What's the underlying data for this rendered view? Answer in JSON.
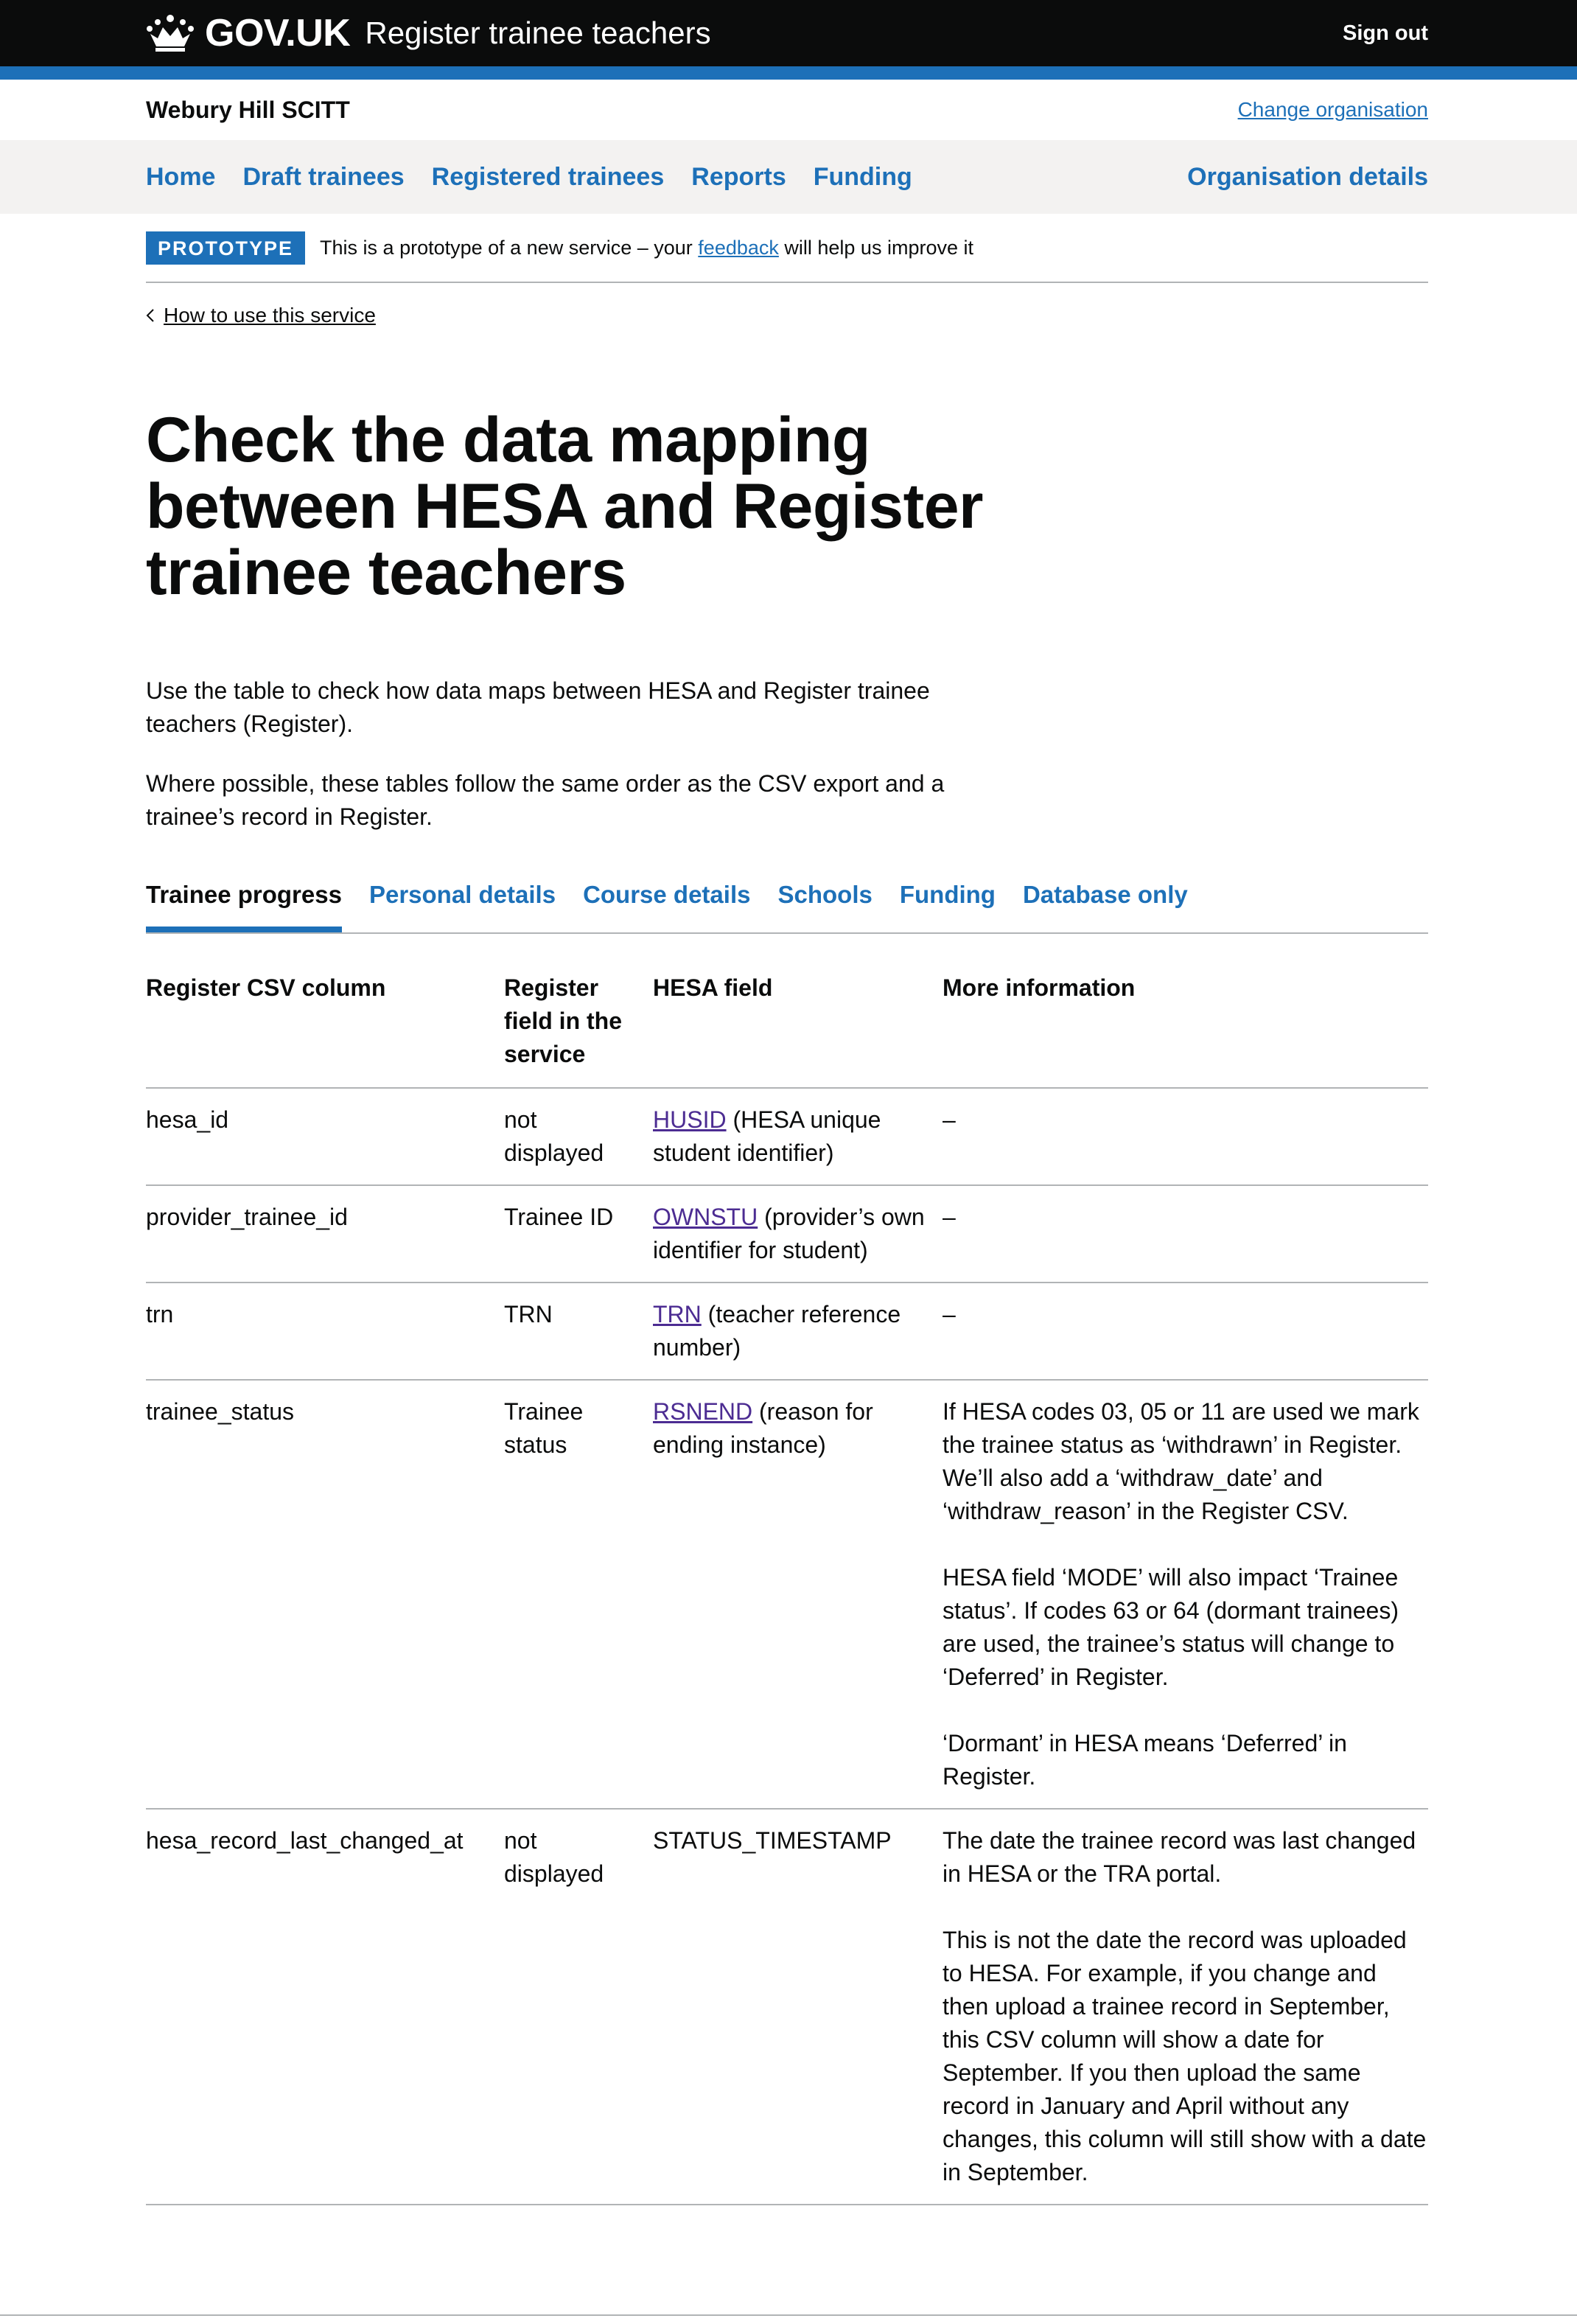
{
  "header": {
    "logo_text": "GOV.UK",
    "service_name": "Register trainee teachers",
    "sign_out": "Sign out"
  },
  "org": {
    "name": "Webury Hill SCITT",
    "change_link": "Change organisation"
  },
  "nav": {
    "items": [
      "Home",
      "Draft trainees",
      "Registered trainees",
      "Reports",
      "Funding"
    ],
    "right": "Organisation details"
  },
  "phase": {
    "tag": "PROTOTYPE",
    "before": "This is a prototype of a new service – your ",
    "link": "feedback",
    "after": " will help us improve it"
  },
  "back_link": "How to use this service",
  "page": {
    "title": "Check the data mapping between HESA and Register trainee teachers",
    "intro_1": "Use the table to check how data maps between HESA and Register trainee teachers (Register).",
    "intro_2": "Where possible, these tables follow the same order as the CSV export and a trainee’s record in Register."
  },
  "tabs": [
    "Trainee progress",
    "Personal details",
    "Course details",
    "Schools",
    "Funding",
    "Database only"
  ],
  "table": {
    "headers": [
      "Register CSV column",
      "Register field in the service",
      "HESA field",
      "More information"
    ],
    "rows": [
      {
        "csv": "hesa_id",
        "register": "not displayed",
        "hesa_link": "HUSID",
        "hesa_text": " (HESA unique student identifier)",
        "info": [
          "–"
        ]
      },
      {
        "csv": "provider_trainee_id",
        "register": "Trainee ID",
        "hesa_link": "OWNSTU",
        "hesa_text": " (provider’s own identifier for student)",
        "info": [
          "–"
        ]
      },
      {
        "csv": "trn",
        "register": "TRN",
        "hesa_link": "TRN",
        "hesa_text": " (teacher reference number)",
        "info": [
          "–"
        ]
      },
      {
        "csv": "trainee_status",
        "register": "Trainee status",
        "hesa_link": "RSNEND",
        "hesa_text": " (reason for ending instance)",
        "info": [
          "If HESA codes 03, 05 or 11 are used we mark the trainee status as ‘withdrawn’ in Register. We’ll also add a ‘withdraw_date’ and ‘withdraw_reason’ in the Register CSV.",
          "HESA field ‘MODE’ will also impact ‘Trainee status’. If codes 63 or 64 (dormant trainees) are used, the trainee’s status will change to ‘Deferred’ in Register.",
          "‘Dormant’ in HESA means ‘Deferred’ in Register."
        ]
      },
      {
        "csv": "hesa_record_last_changed_at",
        "register": "not displayed",
        "hesa_link": "",
        "hesa_text": "STATUS_TIMESTAMP",
        "info": [
          "The date the trainee record was last changed in HESA or the TRA portal.",
          "This is not the date the record was uploaded to HESA. For example, if you change and then upload a trainee record in September, this CSV column will show a date for September. If you then upload the same record in January and April without any changes, this column will still show with a date in September."
        ]
      }
    ]
  },
  "colors": {
    "header_bg": "#0b0c0c",
    "brand_blue": "#1d70b8",
    "link_visited": "#4c2c92",
    "nav_bg": "#f3f2f1",
    "border": "#b1b4b6"
  }
}
